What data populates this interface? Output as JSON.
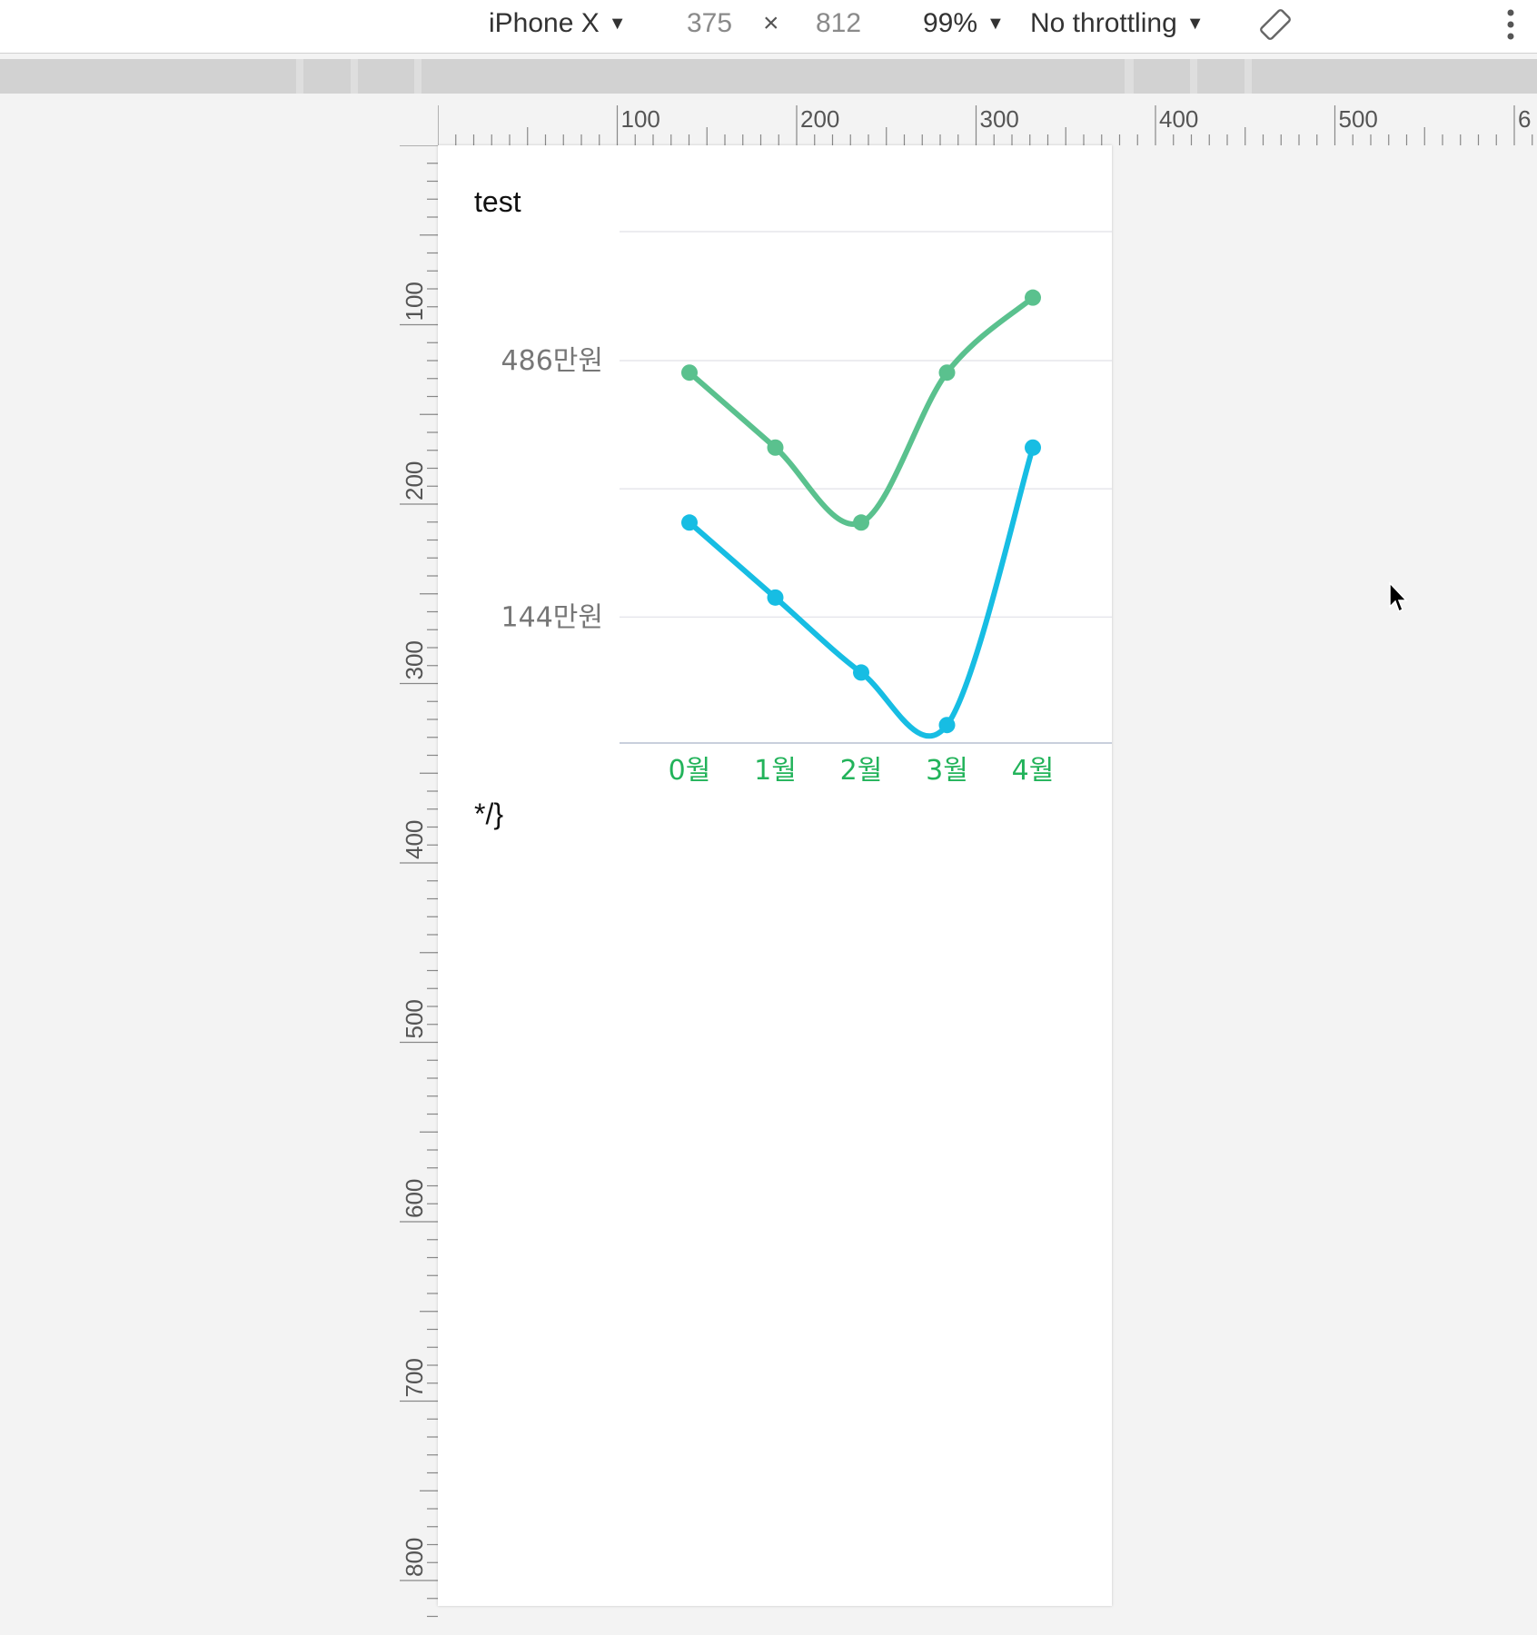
{
  "devtools": {
    "device_name": "iPhone X",
    "width": "375",
    "times_sign": "×",
    "height": "812",
    "zoom": "99%",
    "throttling": "No throttling"
  },
  "ruler": {
    "top_labels": [
      "100",
      "200",
      "300",
      "400",
      "500",
      "6"
    ],
    "left_labels": [
      "100",
      "200",
      "300",
      "400",
      "500",
      "600",
      "700",
      "800"
    ]
  },
  "page": {
    "title": "test",
    "footer_text": "*/}"
  },
  "chart_data": {
    "type": "line",
    "title": "test",
    "categories": [
      "0월",
      "1월",
      "2월",
      "3월",
      "4월"
    ],
    "y_tick_labels": [
      "486만원",
      "144만원"
    ],
    "y_ticks": [
      486,
      144
    ],
    "ylim": [
      -24,
      658
    ],
    "grid": true,
    "smooth": true,
    "series": [
      {
        "color": "#5ac18e",
        "values": [
          470,
          370,
          270,
          470,
          570
        ]
      },
      {
        "color": "#17bde3",
        "values": [
          270,
          170,
          70,
          0,
          370
        ]
      }
    ],
    "x_label_color": "#22b35a",
    "y_label_color": "#777777",
    "grid_color": "#e6e6ec"
  }
}
